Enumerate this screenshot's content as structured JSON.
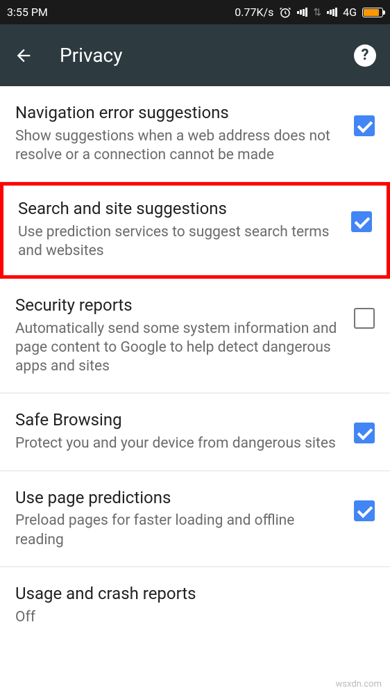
{
  "status": {
    "time": "3:55 PM",
    "speed": "0.77K/s",
    "network": "4G"
  },
  "appbar": {
    "title": "Privacy"
  },
  "settings": [
    {
      "title": "Navigation error suggestions",
      "desc": "Show suggestions when a web address does not resolve or a connection cannot be made",
      "checked": true
    },
    {
      "title": "Search and site suggestions",
      "desc": "Use prediction services to suggest search terms and websites",
      "checked": true,
      "highlighted": true
    },
    {
      "title": "Security reports",
      "desc": "Automatically send some system information and page content to Google to help detect dangerous apps and sites",
      "checked": false
    },
    {
      "title": "Safe Browsing",
      "desc": "Protect you and your device from dangerous sites",
      "checked": true
    },
    {
      "title": "Use page predictions",
      "desc": "Preload pages for faster loading and offline reading",
      "checked": true
    },
    {
      "title": "Usage and crash reports",
      "desc": "Off",
      "checked": null
    }
  ],
  "watermark": "wsxdn.com"
}
